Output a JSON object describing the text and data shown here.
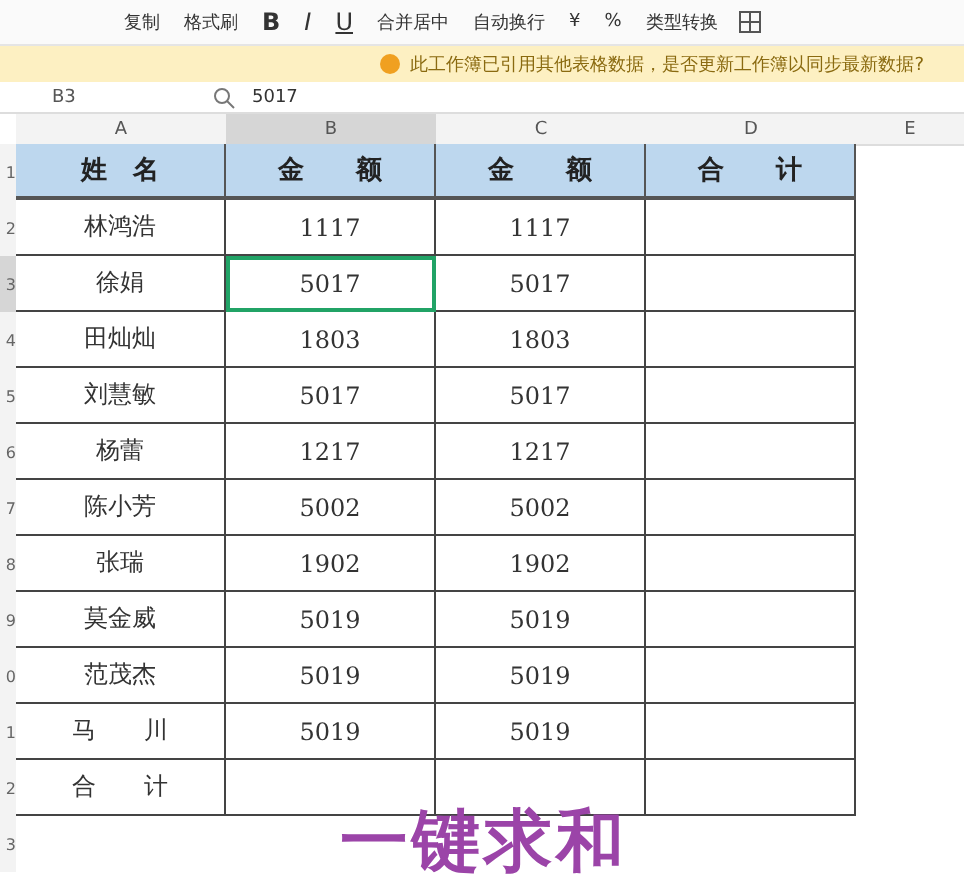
{
  "toolbar": {
    "items": [
      {
        "kind": "text",
        "label": "复制"
      },
      {
        "kind": "text",
        "label": "格式刷"
      },
      {
        "kind": "bold",
        "label": "B"
      },
      {
        "kind": "italic",
        "label": "I"
      },
      {
        "kind": "underline",
        "label": "U"
      },
      {
        "kind": "text",
        "label": "合并居中"
      },
      {
        "kind": "text",
        "label": "自动换行"
      },
      {
        "kind": "text",
        "label": "¥"
      },
      {
        "kind": "text",
        "label": "%"
      },
      {
        "kind": "text",
        "label": "类型转换"
      }
    ]
  },
  "notice": {
    "text": "此工作簿已引用其他表格数据，是否更新工作簿以同步最新数据?"
  },
  "formula_bar": {
    "cell_ref": "B3",
    "value": "5017"
  },
  "sheet": {
    "columns": [
      {
        "label": "A",
        "selected": false
      },
      {
        "label": "B",
        "selected": true
      },
      {
        "label": "C",
        "selected": false
      },
      {
        "label": "D",
        "selected": false
      },
      {
        "label": "E",
        "selected": false
      }
    ],
    "row_numbers": [
      "1",
      "2",
      "3",
      "4",
      "5",
      "6",
      "7",
      "8",
      "9",
      "0",
      "1",
      "2",
      "3"
    ],
    "header": [
      "姓　名",
      "金　　额",
      "金　　额",
      "合　　计"
    ],
    "rows": [
      {
        "cells": [
          {
            "text": "林鸿浩",
            "selected": false
          },
          {
            "text": "1117",
            "selected": false
          },
          {
            "text": "1117",
            "selected": false
          },
          {
            "selected": false
          }
        ]
      },
      {
        "cells": [
          {
            "text": "徐娟",
            "selected": false
          },
          {
            "text": "5017",
            "selected": true
          },
          {
            "text": "5017",
            "selected": false
          },
          {
            "selected": false
          }
        ]
      },
      {
        "cells": [
          {
            "text": "田灿灿",
            "selected": false
          },
          {
            "text": "1803",
            "selected": false
          },
          {
            "text": "1803",
            "selected": false
          },
          {
            "selected": false
          }
        ]
      },
      {
        "cells": [
          {
            "text": "刘慧敏",
            "selected": false
          },
          {
            "text": "5017",
            "selected": false
          },
          {
            "text": "5017",
            "selected": false
          },
          {
            "selected": false
          }
        ]
      },
      {
        "cells": [
          {
            "text": "杨蕾",
            "selected": false
          },
          {
            "text": "1217",
            "selected": false
          },
          {
            "text": "1217",
            "selected": false
          },
          {
            "selected": false
          }
        ]
      },
      {
        "cells": [
          {
            "text": "陈小芳",
            "selected": false
          },
          {
            "text": "5002",
            "selected": false
          },
          {
            "text": "5002",
            "selected": false
          },
          {
            "selected": false
          }
        ]
      },
      {
        "cells": [
          {
            "text": "张瑞",
            "selected": false
          },
          {
            "text": "1902",
            "selected": false
          },
          {
            "text": "1902",
            "selected": false
          },
          {
            "selected": false
          }
        ]
      },
      {
        "cells": [
          {
            "text": "莫金威",
            "selected": false
          },
          {
            "text": "5019",
            "selected": false
          },
          {
            "text": "5019",
            "selected": false
          },
          {
            "selected": false
          }
        ]
      },
      {
        "cells": [
          {
            "text": "范茂杰",
            "selected": false
          },
          {
            "text": "5019",
            "selected": false
          },
          {
            "text": "5019",
            "selected": false
          },
          {
            "selected": false
          }
        ]
      },
      {
        "cells": [
          {
            "text": "马　　川",
            "selected": false
          },
          {
            "text": "5019",
            "selected": false
          },
          {
            "text": "5019",
            "selected": false
          },
          {
            "selected": false
          }
        ]
      },
      {
        "cells": [
          {
            "text": "合　　计",
            "selected": false
          },
          {
            "selected": false
          },
          {
            "selected": false
          },
          {
            "selected": false
          }
        ]
      }
    ]
  },
  "overlay_title": "一键求和"
}
